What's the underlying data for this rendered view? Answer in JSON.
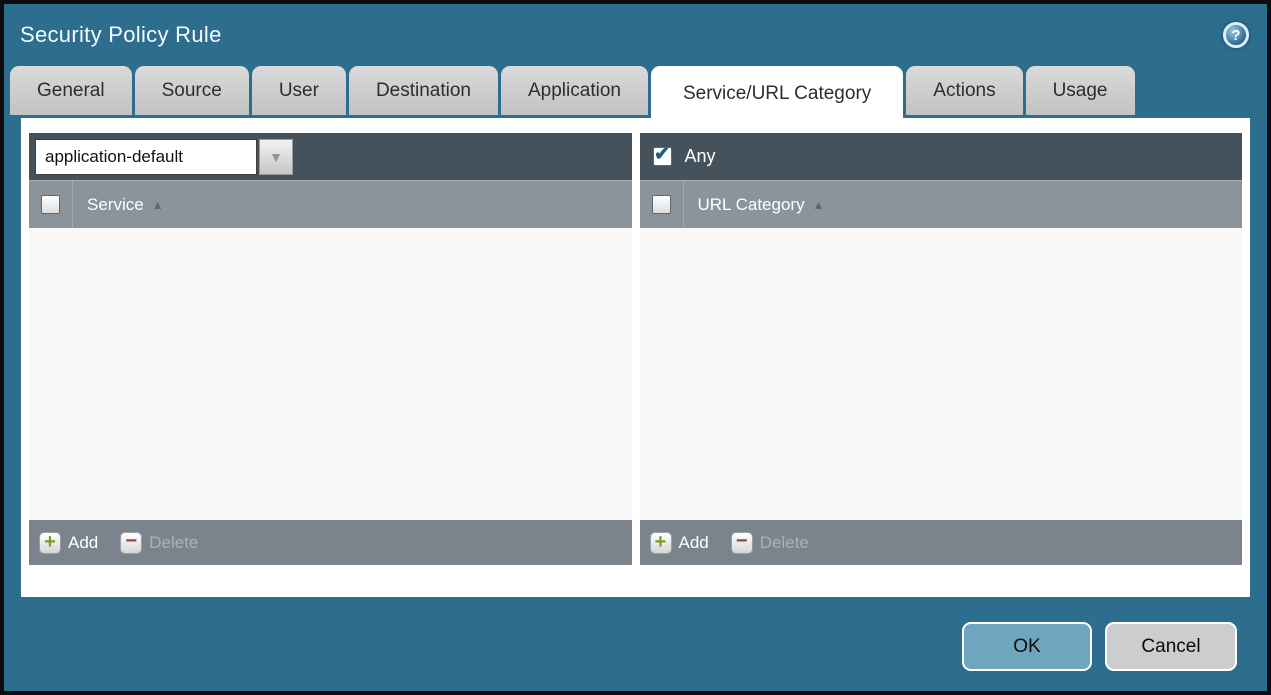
{
  "window": {
    "title": "Security Policy Rule",
    "help_glyph": "?"
  },
  "tabs": [
    {
      "label": "General",
      "active": false
    },
    {
      "label": "Source",
      "active": false
    },
    {
      "label": "User",
      "active": false
    },
    {
      "label": "Destination",
      "active": false
    },
    {
      "label": "Application",
      "active": false
    },
    {
      "label": "Service/URL Category",
      "active": true
    },
    {
      "label": "Actions",
      "active": false
    },
    {
      "label": "Usage",
      "active": false
    }
  ],
  "service_panel": {
    "dropdown": {
      "value": "application-default",
      "arrow_glyph": "▼"
    },
    "header": {
      "label": "Service",
      "sort_glyph": "▲",
      "checkbox_checked": false
    },
    "rows": [],
    "footer": {
      "add_label": "Add",
      "add_glyph": "+",
      "add_enabled": true,
      "delete_label": "Delete",
      "delete_glyph": "−",
      "delete_enabled": false
    }
  },
  "url_category_panel": {
    "any": {
      "label": "Any",
      "checked": true,
      "check_glyph": "✔"
    },
    "header": {
      "label": "URL Category",
      "sort_glyph": "▲",
      "checkbox_checked": false
    },
    "rows": [],
    "footer": {
      "add_label": "Add",
      "add_glyph": "+",
      "add_enabled": true,
      "delete_label": "Delete",
      "delete_glyph": "−",
      "delete_enabled": false
    }
  },
  "dialog_buttons": {
    "ok_label": "OK",
    "cancel_label": "Cancel"
  },
  "colors": {
    "dialog_background": "#2d6d8e",
    "panel_toolbar": "#46525b",
    "panel_header": "#8b949b",
    "panel_footer": "#7b848c",
    "active_tab": "#ffffff",
    "inactive_tab": "#cccccc",
    "ok_button": "#6fa6bf",
    "cancel_button": "#cbcdcf",
    "add_plus": "#7e9a20",
    "delete_minus": "#8a4444",
    "checkmark": "#215e7e"
  }
}
